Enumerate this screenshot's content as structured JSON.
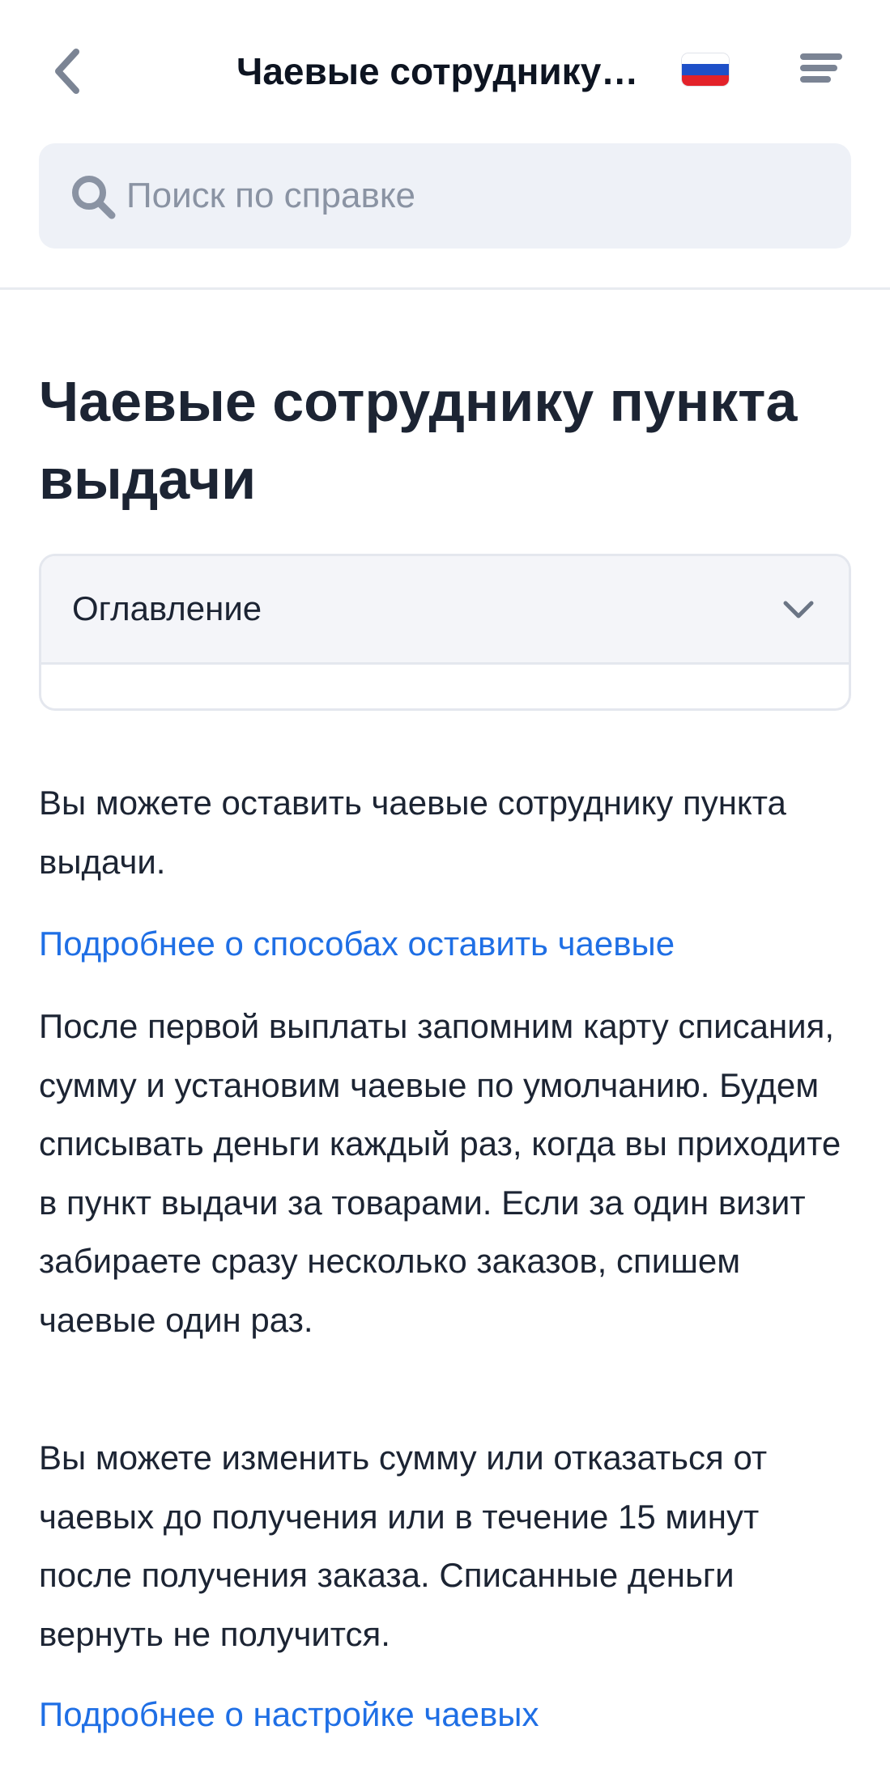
{
  "header": {
    "title": "Чаевые сотруднику пункта выдачи",
    "back_icon": "chevron-left-icon",
    "language_flag": "russia-flag-icon",
    "menu_icon": "menu-icon"
  },
  "search": {
    "placeholder": "Поиск по справке",
    "value": ""
  },
  "article": {
    "title": "Чаевые сотруднику пункта выдачи",
    "toc_label": "Оглавление",
    "paragraphs": [
      "Вы можете оставить чаевые сотруднику пункта выдачи.",
      "После первой выплаты запомним карту списания, сумму и установим чаевые по умолчанию. Будем списывать деньги каждый раз, когда вы приходите в пункт выдачи за товарами. Если за один визит забираете сразу несколько заказов, спишем чаевые один раз.",
      "Вы можете изменить сумму или отказаться от чаевых до получения или в течение 15 минут после получения заказа. Списанные деньги вернуть не получится."
    ],
    "links": [
      "Подробнее о способах оставить чаевые",
      "Подробнее о настройке чаевых"
    ]
  },
  "colors": {
    "link": "#1f6fe5",
    "text": "#1c2433",
    "search_bg": "#eef1f7",
    "icon_gray": "#8a93a3",
    "flag_white": "#ffffff",
    "flag_blue": "#1e50c8",
    "flag_red": "#e3222a"
  }
}
